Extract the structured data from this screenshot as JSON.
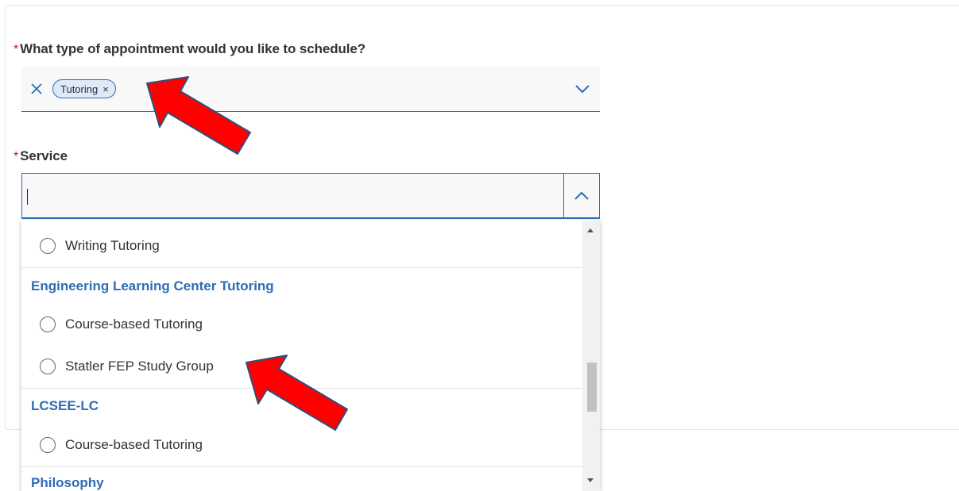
{
  "appointment_field": {
    "required_mark": "*",
    "label": "What type of appointment would you like to schedule?",
    "selected_chip": "Tutoring",
    "chip_remove": "×"
  },
  "service_field": {
    "required_mark": "*",
    "label": "Service",
    "value": ""
  },
  "service_options": {
    "opt_writing": "Writing Tutoring",
    "group_engineering": "Engineering Learning Center Tutoring",
    "opt_eng_course": "Course-based Tutoring",
    "opt_statler": "Statler FEP Study Group",
    "group_lcsee": "LCSEE-LC",
    "opt_lcsee_course": "Course-based Tutoring",
    "group_philosophy": "Philosophy"
  },
  "icons": {
    "clear": "close-icon",
    "dropdown_closed": "chevron-down-icon",
    "dropdown_open": "chevron-up-icon",
    "annotation": "red-arrow-icon"
  },
  "colors": {
    "accent": "#2d6db5",
    "required": "#c8102e",
    "arrow": "#ff0000"
  }
}
